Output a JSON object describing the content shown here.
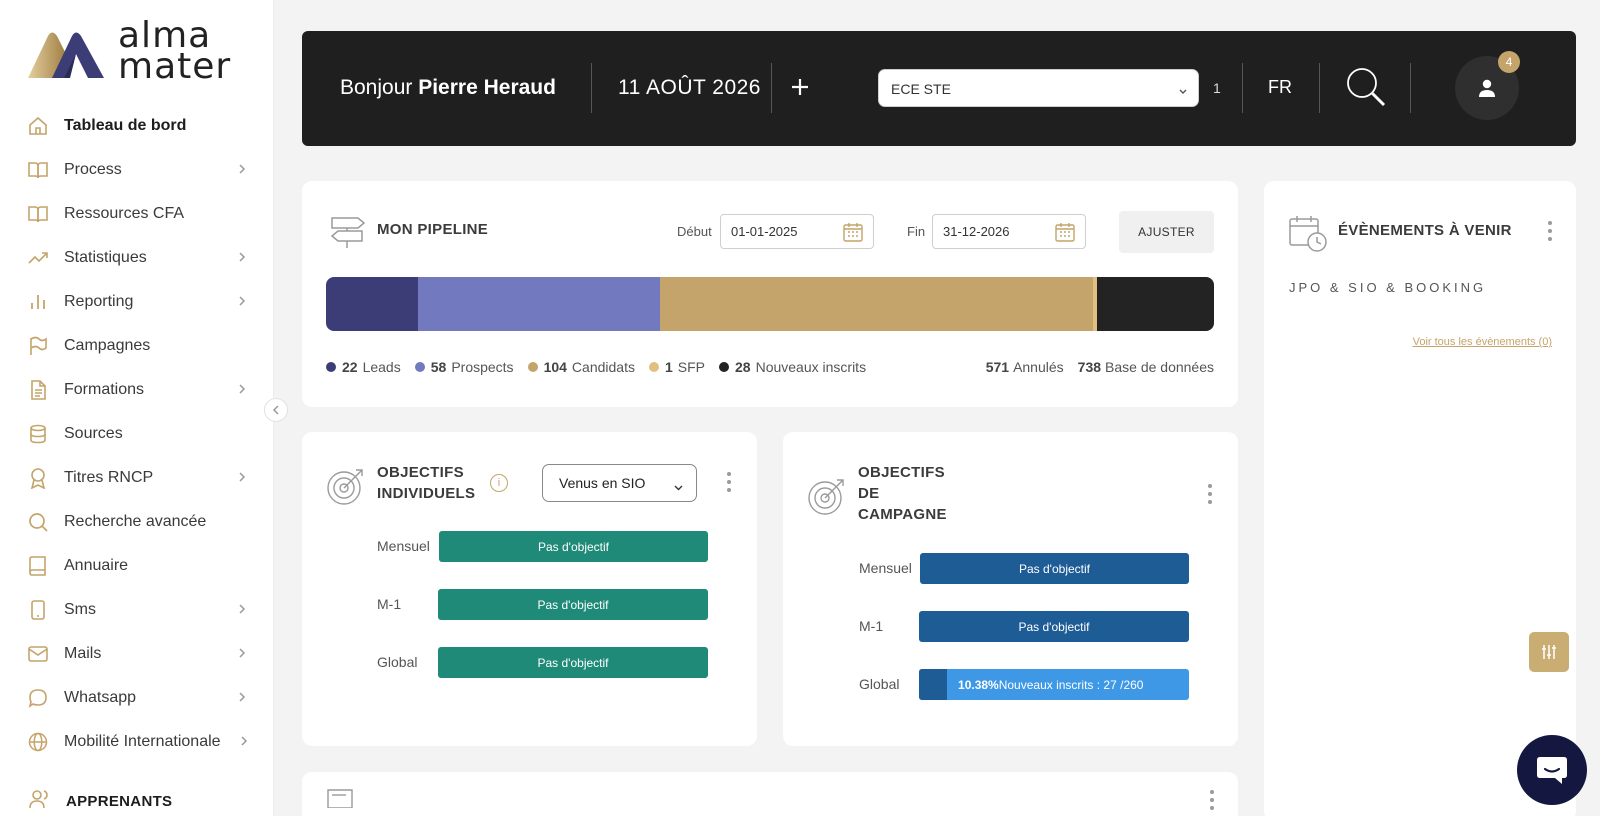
{
  "brand": {
    "logo_text": "alma\nmater",
    "gold": "#c4a46a",
    "navy": "#3c3d77"
  },
  "sidebar": {
    "items": [
      {
        "label": "Tableau de bord",
        "icon": "home-icon",
        "active": true,
        "chevron": false
      },
      {
        "label": "Process",
        "icon": "book-icon",
        "chevron": true
      },
      {
        "label": "Ressources CFA",
        "icon": "book-icon",
        "chevron": false
      },
      {
        "label": "Statistiques",
        "icon": "trending-up-icon",
        "chevron": true
      },
      {
        "label": "Reporting",
        "icon": "bar-chart-icon",
        "chevron": true
      },
      {
        "label": "Campagnes",
        "icon": "flag-icon",
        "chevron": false
      },
      {
        "label": "Formations",
        "icon": "document-icon",
        "chevron": true
      },
      {
        "label": "Sources",
        "icon": "database-icon",
        "chevron": false
      },
      {
        "label": "Titres RNCP",
        "icon": "award-icon",
        "chevron": true
      },
      {
        "label": "Recherche avancée",
        "icon": "search-icon",
        "chevron": false
      },
      {
        "label": "Annuaire",
        "icon": "address-book-icon",
        "chevron": false
      },
      {
        "label": "Sms",
        "icon": "phone-icon",
        "chevron": true
      },
      {
        "label": "Mails",
        "icon": "mail-icon",
        "chevron": true
      },
      {
        "label": "Whatsapp",
        "icon": "chat-bubble-icon",
        "chevron": true
      },
      {
        "label": "Mobilité Internationale",
        "icon": "globe-icon",
        "chevron": true
      }
    ],
    "section": {
      "label": "APPRENANTS",
      "icon": "users-icon"
    }
  },
  "header": {
    "greeting_prefix": "Bonjour ",
    "user_name": "Pierre Heraud",
    "date": "11 AOÛT 2026",
    "school_select": "ECE STE",
    "count": "1",
    "lang": "FR",
    "notifications": "4"
  },
  "pipeline": {
    "title": "MON PIPELINE",
    "start_label": "Début",
    "start_value": "01-01-2025",
    "end_label": "Fin",
    "end_value": "31-12-2026",
    "adjust_label": "AJUSTER",
    "legend": [
      {
        "count": "22",
        "label": "Leads",
        "color": "#3c3d77"
      },
      {
        "count": "58",
        "label": "Prospects",
        "color": "#7279bf"
      },
      {
        "count": "104",
        "label": "Candidats",
        "color": "#c4a46a"
      },
      {
        "count": "1",
        "label": "SFP",
        "color": "#e1c07f"
      },
      {
        "count": "28",
        "label": "Nouveaux inscrits",
        "color": "#232323"
      }
    ],
    "extra": [
      {
        "count": "571",
        "label": "Annulés"
      },
      {
        "count": "738",
        "label": "Base de données"
      }
    ]
  },
  "events": {
    "title": "ÉVÈNEMENTS À VENIR",
    "subtitle": "JPO & SIO & BOOKING",
    "link": "Voir tous les évènements (0)"
  },
  "objectifs_individuels": {
    "title_line1": "OBJECTIFS",
    "title_line2": "INDIVIDUELS",
    "info": "i",
    "select_value": "Venus en SIO",
    "rows": [
      {
        "label": "Mensuel",
        "value": "Pas d'objectif"
      },
      {
        "label": "M-1",
        "value": "Pas d'objectif"
      },
      {
        "label": "Global",
        "value": "Pas d'objectif"
      }
    ]
  },
  "objectifs_campagne": {
    "title_line1": "OBJECTIFS",
    "title_line2": "DE",
    "title_line3": "CAMPAGNE",
    "rows": [
      {
        "label": "Mensuel",
        "value": "Pas d'objectif"
      },
      {
        "label": "M-1",
        "value": "Pas d'objectif"
      },
      {
        "label": "Global",
        "percent": "10.38%",
        "value": "Nouveaux inscrits : 27 /260",
        "progress": 0.1038
      }
    ]
  }
}
